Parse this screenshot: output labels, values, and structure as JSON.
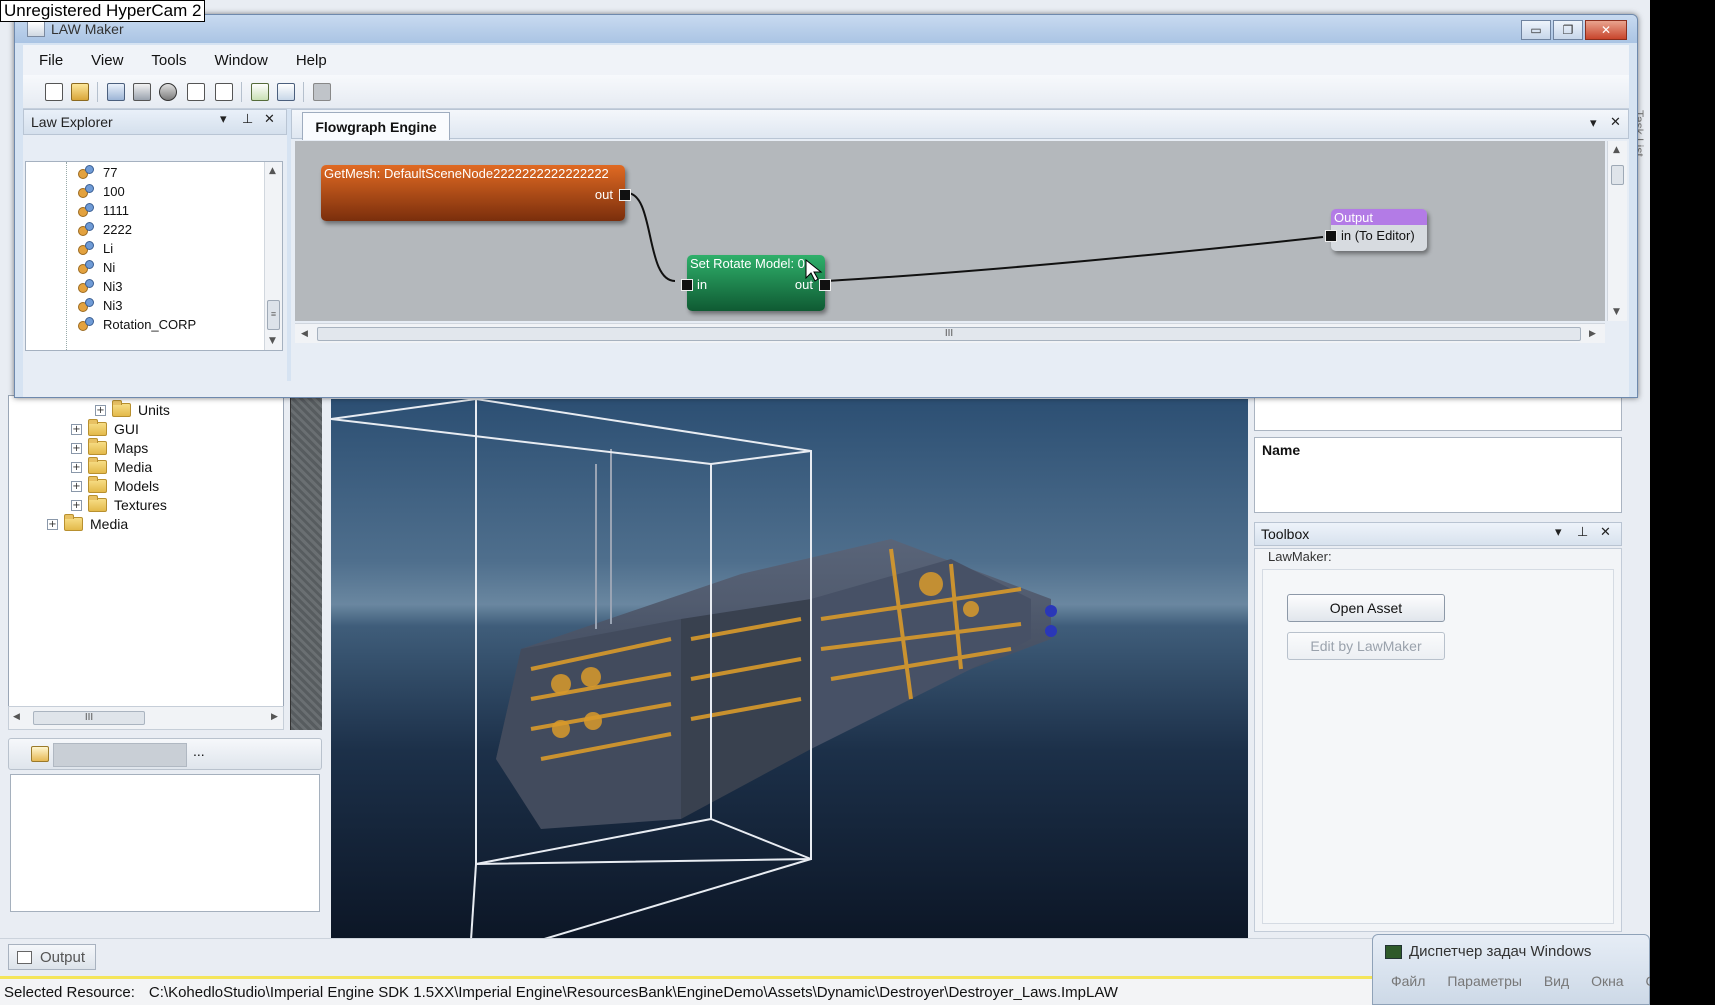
{
  "recorder_watermark": "Unregistered HyperCam 2",
  "law_window": {
    "title": "LAW Maker",
    "controls": {
      "minimize": "▭",
      "maximize": "❐",
      "close": "✕"
    },
    "menu": [
      "File",
      "View",
      "Tools",
      "Window",
      "Help"
    ],
    "explorer": {
      "title": "Law Explorer",
      "items": [
        "77",
        "100",
        "1111",
        "2222",
        "Li",
        "Ni",
        "Ni3",
        "Ni3",
        "Rotation_CORP"
      ]
    },
    "flowgraph": {
      "tab_label": "Flowgraph Engine",
      "nodes": {
        "getmesh": {
          "title": "GetMesh: DefaultSceneNode2222222222222222",
          "out_port": "out",
          "color": "#c8571a"
        },
        "set_rotate": {
          "title": "Set Rotate Model: 0",
          "in_port": "in",
          "out_port": "out",
          "color": "#1f8a52"
        },
        "output": {
          "title": "Output",
          "in_port": "in (To Editor)",
          "color": "#9b5fd0"
        }
      }
    },
    "scroll_glyph": "III"
  },
  "background_app": {
    "resource_tree": {
      "items": [
        {
          "label": "Units",
          "level": 2
        },
        {
          "label": "GUI",
          "level": 1
        },
        {
          "label": "Maps",
          "level": 1
        },
        {
          "label": "Media",
          "level": 1
        },
        {
          "label": "Models",
          "level": 1
        },
        {
          "label": "Textures",
          "level": 1
        },
        {
          "label": "Media",
          "level": 0
        }
      ],
      "scroll_glyph": "III"
    },
    "small_toolbar_ellipsis": "...",
    "properties": {
      "name_label": "Name"
    },
    "toolbox": {
      "title": "Toolbox",
      "group": "LawMaker:",
      "buttons": [
        {
          "label": "Open Asset",
          "enabled": true
        },
        {
          "label": "Edit by LawMaker",
          "enabled": false
        }
      ]
    },
    "output_tab": "Output",
    "status": {
      "label": "Selected Resource:",
      "path": "C:\\KohedloStudio\\Imperial Engine SDK 1.5XX\\Imperial Engine\\ResourcesBank\\EngineDemo\\Assets\\Dynamic\\Destroyer\\Destroyer_Laws.ImpLAW"
    },
    "vertical_tab": "Task List"
  },
  "task_manager": {
    "title": "Диспетчер задач Windows",
    "menu": [
      "Файл",
      "Параметры",
      "Вид",
      "Окна",
      "С"
    ]
  }
}
